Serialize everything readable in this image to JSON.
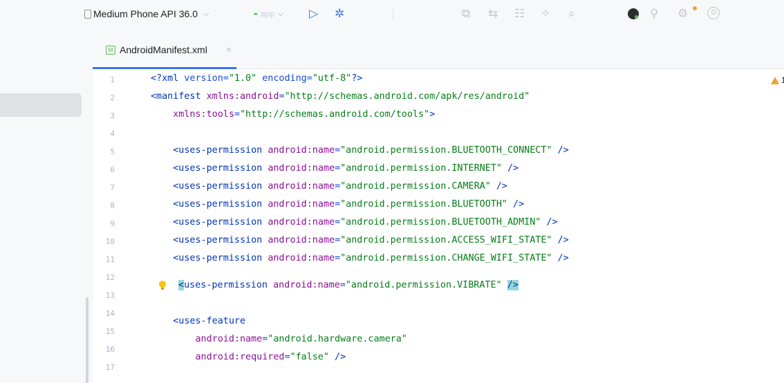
{
  "toolbar": {
    "device": "Medium Phone API 36.0",
    "app_label": "app",
    "icons": [
      "phone-icon",
      "chevron-down-icon",
      "android-app-icon",
      "run-icon",
      "debug-icon",
      "profiler-icon",
      "translate-icon",
      "layout-inspector-icon",
      "bug-icon",
      "device-mirror-icon",
      "record-icon",
      "search-icon",
      "settings-icon",
      "account-icon"
    ]
  },
  "tabs": [
    {
      "label": "AndroidManifest.xml",
      "icon_letter": "M",
      "active": true
    }
  ],
  "editor": {
    "warning_count": "1",
    "line_numbers": [
      "1",
      "2",
      "3",
      "4",
      "5",
      "6",
      "7",
      "8",
      "9",
      "10",
      "11",
      "12",
      "13",
      "14",
      "15",
      "16",
      "17"
    ],
    "lines": [
      {
        "prefix": "<?xml ",
        "attr1": "version=",
        "val1": "\"1.0\"",
        "mid": " encoding=",
        "val2": "\"utf-8\"",
        "suffix": "?>"
      },
      {
        "tag": "<manifest ",
        "ns": "xmlns:android",
        "eq": "=",
        "val": "\"http://schemas.android.com/apk/res/android\""
      },
      {
        "indent": "    ",
        "ns": "xmlns:tools",
        "eq": "=",
        "val": "\"http://schemas.android.com/tools\"",
        "end": ">"
      },
      {
        "text": ""
      },
      {
        "indent": "    ",
        "tag": "<uses-permission ",
        "attr": "android:name",
        "eq": "=",
        "val": "\"android.permission.BLUETOOTH_CONNECT\"",
        "end": " />"
      },
      {
        "indent": "    ",
        "tag": "<uses-permission ",
        "attr": "android:name",
        "eq": "=",
        "val": "\"android.permission.INTERNET\"",
        "end": " />"
      },
      {
        "indent": "    ",
        "tag": "<uses-permission ",
        "attr": "android:name",
        "eq": "=",
        "val": "\"android.permission.CAMERA\"",
        "end": " />"
      },
      {
        "indent": "    ",
        "tag": "<uses-permission ",
        "attr": "android:name",
        "eq": "=",
        "val": "\"android.permission.BLUETOOTH\"",
        "end": " />"
      },
      {
        "indent": "    ",
        "tag": "<uses-permission ",
        "attr": "android:name",
        "eq": "=",
        "val": "\"android.permission.BLUETOOTH_ADMIN\"",
        "end": " />"
      },
      {
        "indent": "    ",
        "tag": "<uses-permission ",
        "attr": "android:name",
        "eq": "=",
        "val": "\"android.permission.ACCESS_WIFI_STATE\"",
        "end": " />"
      },
      {
        "indent": "    ",
        "tag": "<uses-permission ",
        "attr": "android:name",
        "eq": "=",
        "val": "\"android.permission.CHANGE_WIFI_STATE\"",
        "end": " />"
      },
      {
        "indent": "    ",
        "tag": "<uses-permission ",
        "attr": "android:name",
        "eq": "=",
        "val": "\"android.permission.VIBRATE\"",
        "end": " />"
      },
      {
        "text": ""
      },
      {
        "indent": "    ",
        "tag": "<uses-feature"
      },
      {
        "indent": "        ",
        "attr": "android:name",
        "eq": "=",
        "val": "\"android.hardware.camera\""
      },
      {
        "indent": "        ",
        "attr": "android:required",
        "eq": "=",
        "val": "\"false\"",
        "end": " />"
      },
      {
        "text": ""
      }
    ]
  },
  "colors": {
    "tag": "#0033b3",
    "namespace": "#871094",
    "string": "#067d17",
    "brace_highlight": "#93d9d9",
    "accent": "#3574f0"
  }
}
